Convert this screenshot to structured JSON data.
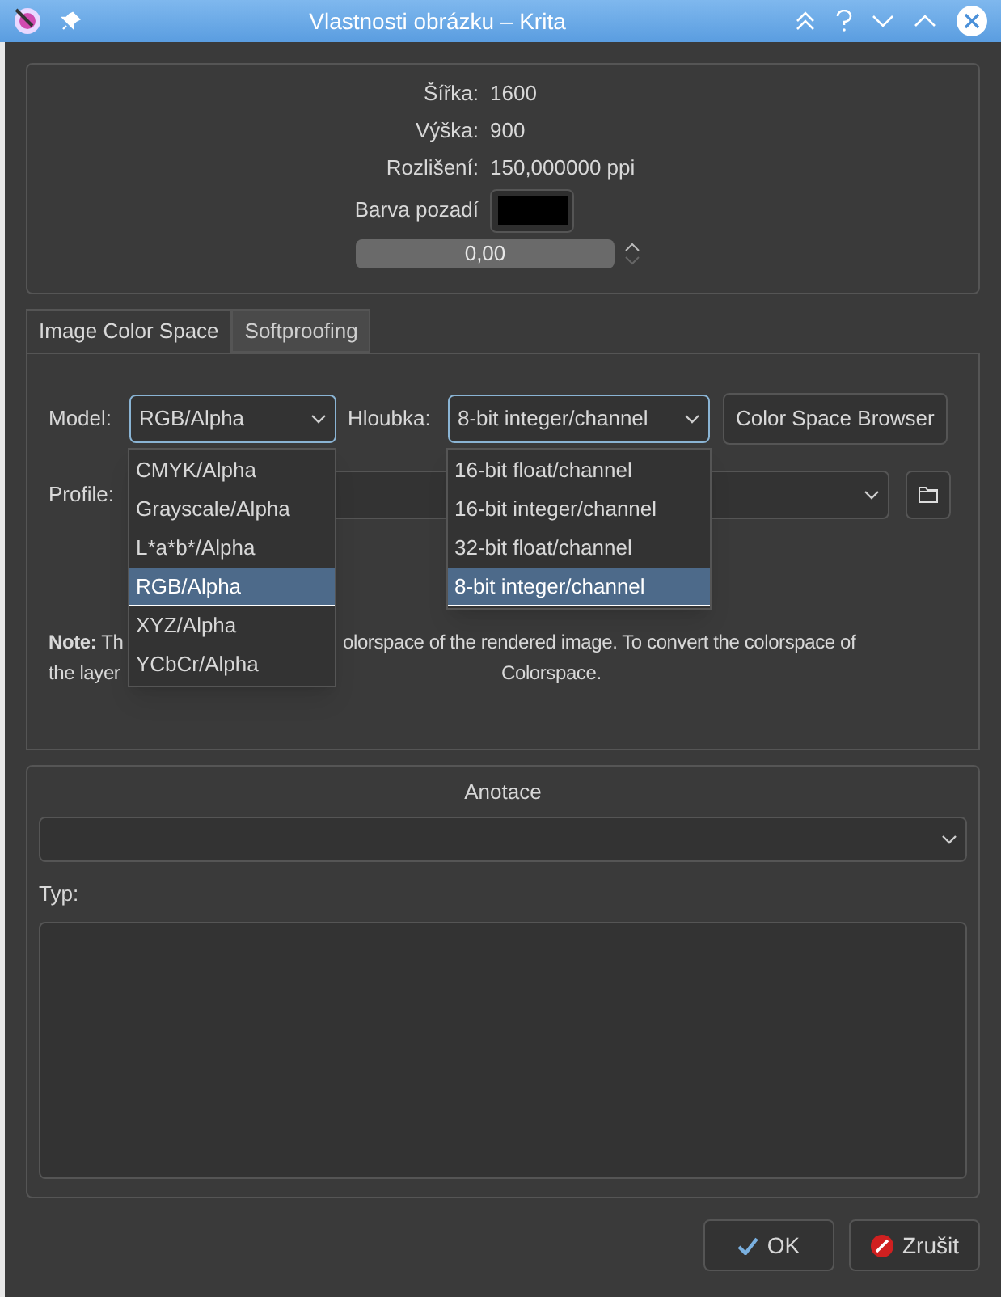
{
  "window": {
    "title": "Vlastnosti obrázku – Krita"
  },
  "image_info": {
    "rows": [
      {
        "label": "Šířka:",
        "value": "1600"
      },
      {
        "label": "Výška:",
        "value": "900"
      },
      {
        "label": "Rozlišení:",
        "value": "150,000000  ppi"
      }
    ],
    "background_label": "Barva pozadí",
    "opacity": {
      "level": 0,
      "value": "0,00"
    }
  },
  "tabs": [
    {
      "label": "Image Color Space",
      "selected": true
    },
    {
      "label": "Softproofing",
      "selected": false
    }
  ],
  "color_space": {
    "model_label": "Model:",
    "model_value": "RGB/Alpha",
    "depth_label": "Hloubka:",
    "depth_value": "8-bit integer/channel",
    "browser_button": "Color Space Browser",
    "profile_label": "Profile:",
    "model_options": [
      {
        "label": "CMYK/Alpha",
        "selected": false
      },
      {
        "label": "Grayscale/Alpha",
        "selected": false
      },
      {
        "label": "L*a*b*/Alpha",
        "selected": false
      },
      {
        "label": "RGB/Alpha",
        "selected": true
      },
      {
        "label": "XYZ/Alpha",
        "selected": false
      },
      {
        "label": "YCbCr/Alpha",
        "selected": false
      }
    ],
    "depth_options": [
      {
        "label": "16-bit float/channel",
        "selected": false
      },
      {
        "label": "16-bit integer/channel",
        "selected": false
      },
      {
        "label": "32-bit float/channel",
        "selected": false
      },
      {
        "label": "8-bit integer/channel",
        "selected": true
      }
    ],
    "note_lines": [
      [
        "**Note:** Th",
        "olorspace of the rendered image. To convert the colorspace of"
      ],
      [
        "the layer",
        "Colorspace."
      ]
    ]
  },
  "annotations": {
    "title": "Anotace",
    "type_label": "Typ:"
  },
  "buttons": [
    {
      "label": "OK",
      "kind": "ok"
    },
    {
      "label": "Zrušit",
      "kind": "cancel"
    }
  ]
}
